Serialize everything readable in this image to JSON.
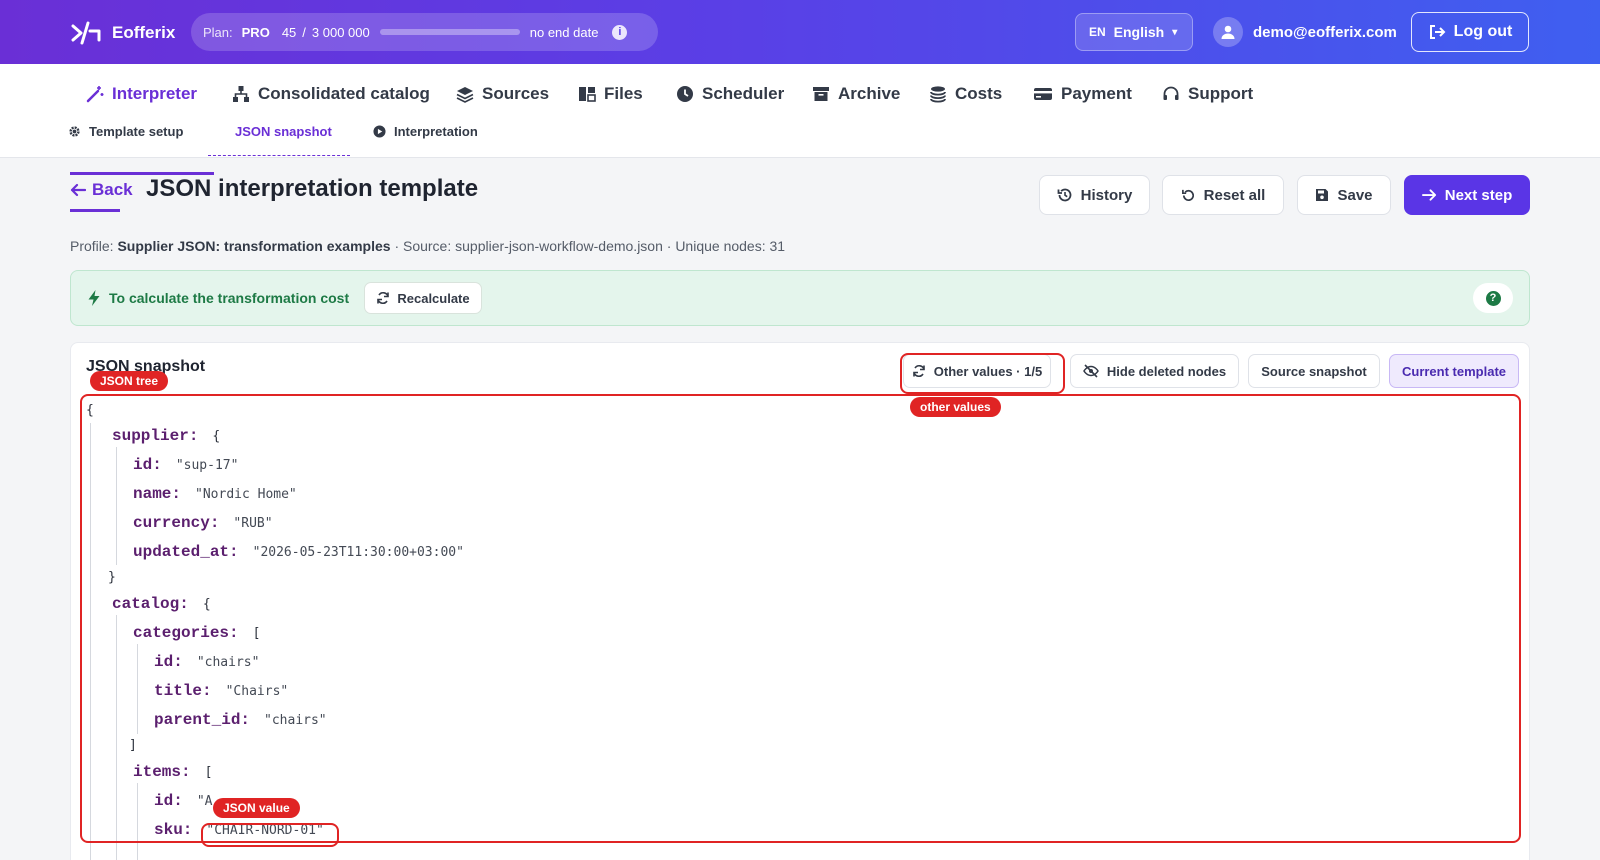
{
  "app": {
    "name": "Eofferix"
  },
  "plan": {
    "label": "Plan:",
    "tier": "PRO",
    "usage": "45",
    "separator": "/",
    "limit": "3 000 000",
    "usage_fraction": 1.5e-05,
    "end_date": "no end date",
    "info_icon": "i"
  },
  "language": {
    "code": "EN",
    "name": "English",
    "caret": "▾"
  },
  "user": {
    "email": "demo@eofferix.com"
  },
  "logout": {
    "label": "Log out"
  },
  "nav": {
    "tabs": [
      {
        "label": "Interpreter",
        "icon": "magic-wand-icon",
        "active": true
      },
      {
        "label": "Consolidated catalog",
        "icon": "sitemap-icon"
      },
      {
        "label": "Sources",
        "icon": "layers-icon"
      },
      {
        "label": "Files",
        "icon": "files-icon"
      },
      {
        "label": "Scheduler",
        "icon": "clock-icon"
      },
      {
        "label": "Archive",
        "icon": "archive-icon"
      },
      {
        "label": "Costs",
        "icon": "coins-icon"
      },
      {
        "label": "Payment",
        "icon": "card-icon"
      },
      {
        "label": "Support",
        "icon": "headset-icon"
      }
    ]
  },
  "subnav": {
    "tabs": [
      {
        "label": "Template setup",
        "icon": "gear-icon"
      },
      {
        "label": "JSON snapshot",
        "active": true
      },
      {
        "label": "Interpretation",
        "icon": "play-circle-icon"
      }
    ]
  },
  "header": {
    "back": "Back",
    "title": "JSON interpretation template",
    "actions": {
      "history": "History",
      "reset": "Reset all",
      "save": "Save",
      "next": "Next step"
    }
  },
  "meta": {
    "profile_label": "Profile:",
    "profile": "Supplier JSON: transformation examples",
    "source": "· Source: supplier-json-workflow-demo.json",
    "nodes": "· Unique nodes: 31"
  },
  "banner": {
    "text": "To calculate the transformation cost",
    "recalculate": "Recalculate",
    "help": "?"
  },
  "snapshot": {
    "title": "JSON snapshot",
    "buttons": {
      "other_values": "Other values · 1/5",
      "hide_deleted": "Hide deleted nodes",
      "source": "Source snapshot",
      "current": "Current template"
    },
    "tree": {
      "open": "{",
      "supplier_key": "supplier:",
      "supplier_open": "{",
      "supplier": [
        {
          "key": "id:",
          "value": "\"sup-17\""
        },
        {
          "key": "name:",
          "value": "\"Nordic Home\""
        },
        {
          "key": "currency:",
          "value": "\"RUB\""
        },
        {
          "key": "updated_at:",
          "value": "\"2026-05-23T11:30:00+03:00\""
        }
      ],
      "supplier_close": "}",
      "catalog_key": "catalog:",
      "catalog_open": "{",
      "categories_key": "categories:",
      "categories_open": "[",
      "categories": [
        {
          "key": "id:",
          "value": "\"chairs\""
        },
        {
          "key": "title:",
          "value": "\"Chairs\""
        },
        {
          "key": "parent_id:",
          "value": "\"chairs\""
        }
      ],
      "categories_close": "]",
      "items_key": "items:",
      "items_open": "[",
      "items": [
        {
          "key": "id:",
          "value": "\"A"
        },
        {
          "key": "sku:",
          "value": "\"CHAIR-NORD-01\""
        }
      ]
    }
  },
  "annotations": {
    "json_tree": "JSON tree",
    "other_values": "other values",
    "json_value": "JSON value"
  },
  "colors": {
    "accent": "#6a2fd6",
    "primary_button": "#5a35e6",
    "annotation": "#e02424",
    "banner_bg": "#e4f5ec",
    "banner_text": "#1d7a45",
    "json_key": "#5b1f6e"
  }
}
